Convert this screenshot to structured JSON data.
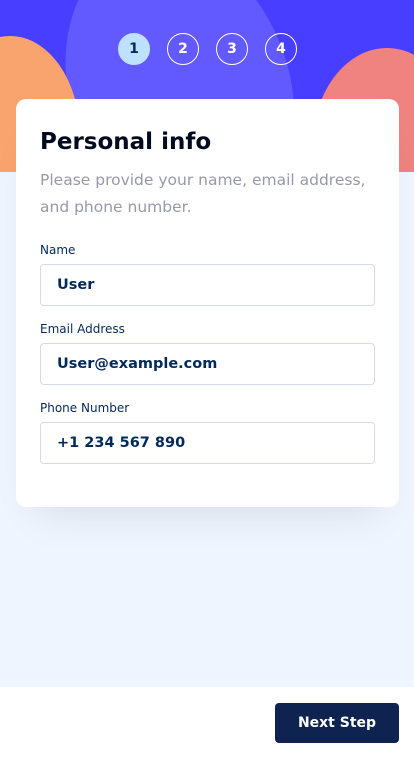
{
  "steps": [
    {
      "number": "1",
      "active": true
    },
    {
      "number": "2",
      "active": false
    },
    {
      "number": "3",
      "active": false
    },
    {
      "number": "4",
      "active": false
    }
  ],
  "form": {
    "title": "Personal info",
    "subtitle": "Please provide your name, email address, and phone number.",
    "fields": [
      {
        "label": "Name",
        "value": "User"
      },
      {
        "label": "Email Address",
        "value": "User@example.com"
      },
      {
        "label": "Phone Number",
        "value": "+1 234 567 890"
      }
    ]
  },
  "footer": {
    "next_label": "Next Step"
  },
  "colors": {
    "banner": "#483eff",
    "active_step": "#bee2fd",
    "primary_text": "#02295a",
    "button": "#0f2350",
    "page_bg": "#eff5ff"
  }
}
